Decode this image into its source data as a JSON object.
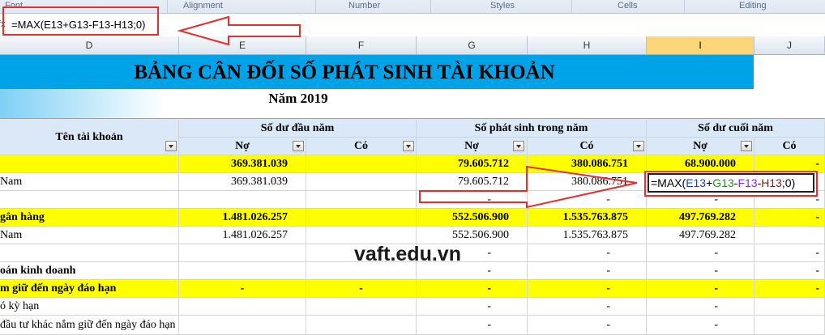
{
  "ribbon": {
    "groups": [
      "Font",
      "Alignment",
      "Number",
      "Styles",
      "Cells",
      "Editing"
    ]
  },
  "formula_bar": {
    "fx": "fx",
    "formula": "=MAX(E13+G13-F13-H13;0)"
  },
  "columns": [
    "D",
    "E",
    "F",
    "G",
    "H",
    "I",
    "J"
  ],
  "selected_column": "I",
  "title": "BẢNG CÂN ĐỐI SỐ PHÁT SINH TÀI KHOẢN",
  "subtitle": "Năm 2019",
  "header": {
    "account": "Tên tài khoản",
    "opening": "Số dư đầu năm",
    "period": "Số phát sinh trong năm",
    "closing": "Số dư cuối năm",
    "debit": "Nợ",
    "credit": "Có"
  },
  "rows": [
    {
      "name": "",
      "e": "369.381.039",
      "f": "",
      "g": "79.605.712",
      "h": "380.086.751",
      "i": "68.900.000",
      "j": "-",
      "style": "yellow"
    },
    {
      "name": "Nam",
      "e": "369.381.039",
      "f": "",
      "g": "79.605.712",
      "h": "380.086.751",
      "i": "",
      "j": "",
      "style": "normal"
    },
    {
      "name": "",
      "e": "",
      "f": "",
      "g": "-",
      "h": "-",
      "i": "-",
      "j": "-",
      "style": "normal"
    },
    {
      "name": "gân hàng",
      "e": "1.481.026.257",
      "f": "",
      "g": "552.506.900",
      "h": "1.535.763.875",
      "i": "497.769.282",
      "j": "-",
      "style": "yellow"
    },
    {
      "name": "Nam",
      "e": "1.481.026.257",
      "f": "",
      "g": "552.506.900",
      "h": "1.535.763.875",
      "i": "497.769.282",
      "j": "",
      "style": "normal"
    },
    {
      "name": "",
      "e": "",
      "f": "",
      "g": "-",
      "h": "-",
      "i": "-",
      "j": "-",
      "style": "normal"
    },
    {
      "name": "oán kinh doanh",
      "e": "",
      "f": "",
      "g": "-",
      "h": "-",
      "i": "-",
      "j": "-",
      "style": "boldname"
    },
    {
      "name": "m giữ đến ngày đáo hạn",
      "e": "-",
      "f": "-",
      "g": "-",
      "h": "-",
      "i": "-",
      "j": "-",
      "style": "yellow"
    },
    {
      "name": "ó kỳ hạn",
      "e": "",
      "f": "",
      "g": "-",
      "h": "-",
      "i": "-",
      "j": "",
      "style": "normal"
    },
    {
      "name": "đầu tư khác nắm giữ đến ngày đáo hạn",
      "e": "",
      "f": "",
      "g": "-",
      "h": "-",
      "i": "-",
      "j": "",
      "style": "normal"
    }
  ],
  "editing_cell": {
    "prefix": "=MAX(",
    "refs": [
      {
        "t": "E13",
        "color": "#1f3fbf"
      },
      {
        "t": "+",
        "color": "#000000"
      },
      {
        "t": "G13",
        "color": "#2e8b2e"
      },
      {
        "t": "-",
        "color": "#000000"
      },
      {
        "t": "F13",
        "color": "#8a2be2"
      },
      {
        "t": "-",
        "color": "#000000"
      },
      {
        "t": "H13",
        "color": "#7a1f1f"
      }
    ],
    "suffix": ";0)"
  },
  "watermark": "vaft.edu.vn",
  "colors": {
    "banner": "#00a2e8",
    "highlight": "#ffff00",
    "annotation": "#e03030"
  }
}
